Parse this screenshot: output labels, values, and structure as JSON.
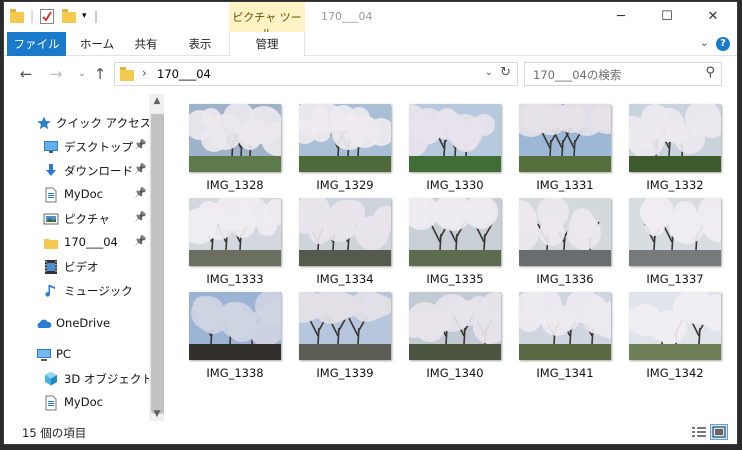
{
  "titlebar": {
    "context_tab": "ピクチャ ツール",
    "title": "170___04",
    "minimize_glyph": "─",
    "maximize_glyph": "☐",
    "close_glyph": "✕"
  },
  "ribbon": {
    "tabs": [
      "ファイル",
      "ホーム",
      "共有",
      "表示",
      "管理"
    ],
    "help_glyph": "?"
  },
  "address": {
    "path": "170___04",
    "search_placeholder": "170___04の検索"
  },
  "nav_pane": {
    "items": [
      {
        "label": "クイック アクセス",
        "icon": "star-icon",
        "pinned": false
      },
      {
        "label": "デスクトップ",
        "icon": "desktop-icon",
        "pinned": true
      },
      {
        "label": "ダウンロード",
        "icon": "download-icon",
        "pinned": true
      },
      {
        "label": "MyDoc",
        "icon": "document-icon",
        "pinned": true
      },
      {
        "label": "ピクチャ",
        "icon": "pictures-icon",
        "pinned": true
      },
      {
        "label": "170___04",
        "icon": "folder-icon",
        "pinned": true
      },
      {
        "label": "ビデオ",
        "icon": "video-icon",
        "pinned": false
      },
      {
        "label": "ミュージック",
        "icon": "music-icon",
        "pinned": false
      },
      {
        "label": "OneDrive",
        "icon": "onedrive-icon",
        "pinned": false
      },
      {
        "label": "PC",
        "icon": "pc-icon",
        "pinned": false
      },
      {
        "label": "3D オブジェクト",
        "icon": "3d-objects-icon",
        "pinned": false
      },
      {
        "label": "MyDoc",
        "icon": "document-icon",
        "pinned": false
      }
    ]
  },
  "files": [
    {
      "name": "IMG_1328",
      "sky": "#9fb3c8",
      "ground": "#5f7a4a",
      "blossom": "#ece8ee"
    },
    {
      "name": "IMG_1329",
      "sky": "#a9bfd6",
      "ground": "#4d6b3a",
      "blossom": "#efeaf0"
    },
    {
      "name": "IMG_1330",
      "sky": "#b7c9dc",
      "ground": "#3f6d35",
      "blossom": "#e8e3ec"
    },
    {
      "name": "IMG_1331",
      "sky": "#9db8d6",
      "ground": "#56703d",
      "blossom": "#e6e2e8"
    },
    {
      "name": "IMG_1332",
      "sky": "#c9d3dc",
      "ground": "#3d5a2c",
      "blossom": "#ede9ef"
    },
    {
      "name": "IMG_1333",
      "sky": "#d3d8de",
      "ground": "#6b6f62",
      "blossom": "#efedf2"
    },
    {
      "name": "IMG_1334",
      "sky": "#cdd4dc",
      "ground": "#545a4c",
      "blossom": "#e9e5ec"
    },
    {
      "name": "IMG_1335",
      "sky": "#c8cfd6",
      "ground": "#5d6b4f",
      "blossom": "#eeebf1"
    },
    {
      "name": "IMG_1336",
      "sky": "#d4d9de",
      "ground": "#6a6d70",
      "blossom": "#ebe8ee"
    },
    {
      "name": "IMG_1337",
      "sky": "#d8dde2",
      "ground": "#77797a",
      "blossom": "#f0edf2"
    },
    {
      "name": "IMG_1338",
      "sky": "#9bb3d4",
      "ground": "#33302c",
      "blossom": "#cfd4e3"
    },
    {
      "name": "IMG_1339",
      "sky": "#b5c6dd",
      "ground": "#5b5d55",
      "blossom": "#e2e0e6"
    },
    {
      "name": "IMG_1340",
      "sky": "#c2cad4",
      "ground": "#4b5540",
      "blossom": "#e8e4eb"
    },
    {
      "name": "IMG_1341",
      "sky": "#cfd6df",
      "ground": "#5a6a44",
      "blossom": "#eeeaf0"
    },
    {
      "name": "IMG_1342",
      "sky": "#dfe5eb",
      "ground": "#6e7e56",
      "blossom": "#f1eef3"
    }
  ],
  "status": {
    "item_count": "15 個の項目"
  },
  "colors": {
    "accent": "#1979ca",
    "context_tab_bg": "#fff2c4"
  }
}
